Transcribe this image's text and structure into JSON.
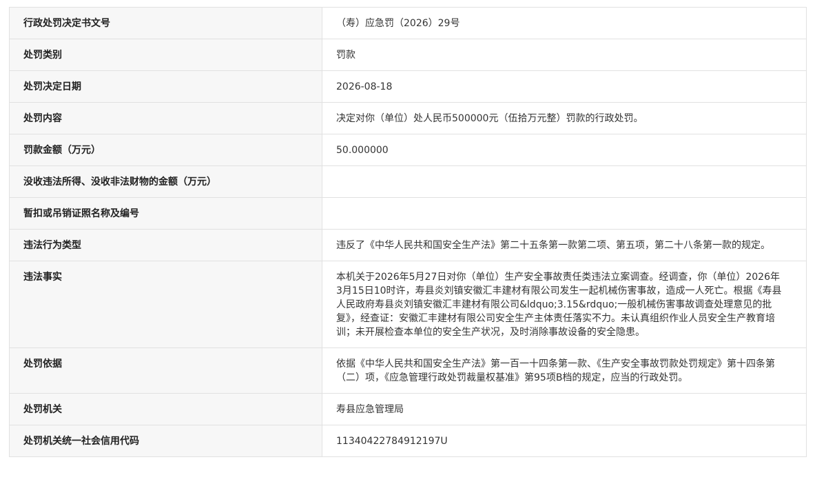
{
  "rows": [
    {
      "key": "decision_no",
      "label": "行政处罚决定书文号",
      "value": "（寿）应急罚（2026）29号"
    },
    {
      "key": "category",
      "label": "处罚类别",
      "value": "罚款"
    },
    {
      "key": "decision_date",
      "label": "处罚决定日期",
      "value": "2026-08-18"
    },
    {
      "key": "content",
      "label": "处罚内容",
      "value": "决定对你（单位）处人民币500000元（伍拾万元整）罚款的行政处罚。"
    },
    {
      "key": "fine_amount",
      "label": "罚款金额（万元）",
      "value": "50.000000"
    },
    {
      "key": "confiscation",
      "label": "没收违法所得、没收非法财物的金额（万元）",
      "value": ""
    },
    {
      "key": "license",
      "label": "暂扣或吊销证照名称及编号",
      "value": ""
    },
    {
      "key": "violation_type",
      "label": "违法行为类型",
      "value": "违反了《中华人民共和国安全生产法》第二十五条第一款第二项、第五项，第二十八条第一款的规定。"
    },
    {
      "key": "facts",
      "label": "违法事实",
      "value": "本机关于2026年5月27日对你（单位）生产安全事故责任类违法立案调查。经调查，你（单位）2026年3月15日10时许，寿县炎刘镇安徽汇丰建材有限公司发生一起机械伤害事故，造成一人死亡。根据《寿县人民政府寿县炎刘镇安徽汇丰建材有限公司&ldquo;3.15&rdquo;一般机械伤害事故调查处理意见的批复》，经查证：安徽汇丰建材有限公司安全生产主体责任落实不力。未认真组织作业人员安全生产教育培训；未开展检查本单位的安全生产状况，及时消除事故设备的安全隐患。"
    },
    {
      "key": "basis",
      "label": "处罚依据",
      "value": "依据《中华人民共和国安全生产法》第一百一十四条第一款、《生产安全事故罚款处罚规定》第十四条第（二）项，《应急管理行政处罚裁量权基准》第95项B档的规定，应当的行政处罚。"
    },
    {
      "key": "authority",
      "label": "处罚机关",
      "value": "寿县应急管理局"
    },
    {
      "key": "credit_code",
      "label": "处罚机关统一社会信用代码",
      "value": "11340422784912197U"
    }
  ]
}
